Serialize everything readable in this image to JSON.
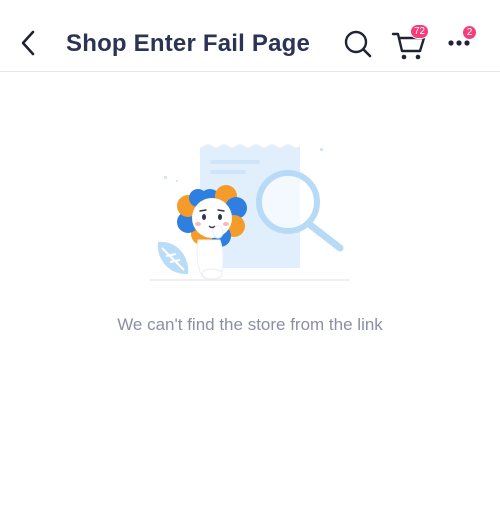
{
  "header": {
    "title": "Shop Enter Fail Page",
    "cart_badge": "72",
    "more_badge": "2"
  },
  "icons": {
    "back": "chevron-left-icon",
    "search": "search-icon",
    "cart": "cart-icon",
    "more": "more-dots-icon"
  },
  "empty_state": {
    "message": "We can't find the store from the link"
  },
  "colors": {
    "title": "#2b3453",
    "badge": "#f53d7a",
    "message": "#8a8fa3",
    "illustration_blue": "#cfe6fb",
    "mascot_orange": "#f59b2a",
    "mascot_blue": "#2f7fe0"
  }
}
